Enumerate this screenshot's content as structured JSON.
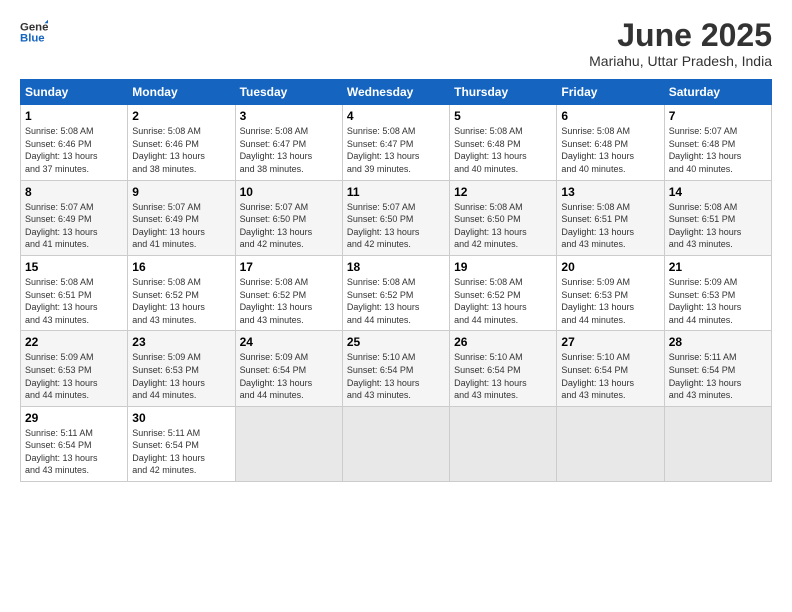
{
  "header": {
    "logo_line1": "General",
    "logo_line2": "Blue",
    "month": "June 2025",
    "location": "Mariahu, Uttar Pradesh, India"
  },
  "weekdays": [
    "Sunday",
    "Monday",
    "Tuesday",
    "Wednesday",
    "Thursday",
    "Friday",
    "Saturday"
  ],
  "weeks": [
    [
      {
        "day": "1",
        "info": "Sunrise: 5:08 AM\nSunset: 6:46 PM\nDaylight: 13 hours\nand 37 minutes."
      },
      {
        "day": "2",
        "info": "Sunrise: 5:08 AM\nSunset: 6:46 PM\nDaylight: 13 hours\nand 38 minutes."
      },
      {
        "day": "3",
        "info": "Sunrise: 5:08 AM\nSunset: 6:47 PM\nDaylight: 13 hours\nand 38 minutes."
      },
      {
        "day": "4",
        "info": "Sunrise: 5:08 AM\nSunset: 6:47 PM\nDaylight: 13 hours\nand 39 minutes."
      },
      {
        "day": "5",
        "info": "Sunrise: 5:08 AM\nSunset: 6:48 PM\nDaylight: 13 hours\nand 40 minutes."
      },
      {
        "day": "6",
        "info": "Sunrise: 5:08 AM\nSunset: 6:48 PM\nDaylight: 13 hours\nand 40 minutes."
      },
      {
        "day": "7",
        "info": "Sunrise: 5:07 AM\nSunset: 6:48 PM\nDaylight: 13 hours\nand 40 minutes."
      }
    ],
    [
      {
        "day": "8",
        "info": "Sunrise: 5:07 AM\nSunset: 6:49 PM\nDaylight: 13 hours\nand 41 minutes."
      },
      {
        "day": "9",
        "info": "Sunrise: 5:07 AM\nSunset: 6:49 PM\nDaylight: 13 hours\nand 41 minutes."
      },
      {
        "day": "10",
        "info": "Sunrise: 5:07 AM\nSunset: 6:50 PM\nDaylight: 13 hours\nand 42 minutes."
      },
      {
        "day": "11",
        "info": "Sunrise: 5:07 AM\nSunset: 6:50 PM\nDaylight: 13 hours\nand 42 minutes."
      },
      {
        "day": "12",
        "info": "Sunrise: 5:08 AM\nSunset: 6:50 PM\nDaylight: 13 hours\nand 42 minutes."
      },
      {
        "day": "13",
        "info": "Sunrise: 5:08 AM\nSunset: 6:51 PM\nDaylight: 13 hours\nand 43 minutes."
      },
      {
        "day": "14",
        "info": "Sunrise: 5:08 AM\nSunset: 6:51 PM\nDaylight: 13 hours\nand 43 minutes."
      }
    ],
    [
      {
        "day": "15",
        "info": "Sunrise: 5:08 AM\nSunset: 6:51 PM\nDaylight: 13 hours\nand 43 minutes."
      },
      {
        "day": "16",
        "info": "Sunrise: 5:08 AM\nSunset: 6:52 PM\nDaylight: 13 hours\nand 43 minutes."
      },
      {
        "day": "17",
        "info": "Sunrise: 5:08 AM\nSunset: 6:52 PM\nDaylight: 13 hours\nand 43 minutes."
      },
      {
        "day": "18",
        "info": "Sunrise: 5:08 AM\nSunset: 6:52 PM\nDaylight: 13 hours\nand 44 minutes."
      },
      {
        "day": "19",
        "info": "Sunrise: 5:08 AM\nSunset: 6:52 PM\nDaylight: 13 hours\nand 44 minutes."
      },
      {
        "day": "20",
        "info": "Sunrise: 5:09 AM\nSunset: 6:53 PM\nDaylight: 13 hours\nand 44 minutes."
      },
      {
        "day": "21",
        "info": "Sunrise: 5:09 AM\nSunset: 6:53 PM\nDaylight: 13 hours\nand 44 minutes."
      }
    ],
    [
      {
        "day": "22",
        "info": "Sunrise: 5:09 AM\nSunset: 6:53 PM\nDaylight: 13 hours\nand 44 minutes."
      },
      {
        "day": "23",
        "info": "Sunrise: 5:09 AM\nSunset: 6:53 PM\nDaylight: 13 hours\nand 44 minutes."
      },
      {
        "day": "24",
        "info": "Sunrise: 5:09 AM\nSunset: 6:54 PM\nDaylight: 13 hours\nand 44 minutes."
      },
      {
        "day": "25",
        "info": "Sunrise: 5:10 AM\nSunset: 6:54 PM\nDaylight: 13 hours\nand 43 minutes."
      },
      {
        "day": "26",
        "info": "Sunrise: 5:10 AM\nSunset: 6:54 PM\nDaylight: 13 hours\nand 43 minutes."
      },
      {
        "day": "27",
        "info": "Sunrise: 5:10 AM\nSunset: 6:54 PM\nDaylight: 13 hours\nand 43 minutes."
      },
      {
        "day": "28",
        "info": "Sunrise: 5:11 AM\nSunset: 6:54 PM\nDaylight: 13 hours\nand 43 minutes."
      }
    ],
    [
      {
        "day": "29",
        "info": "Sunrise: 5:11 AM\nSunset: 6:54 PM\nDaylight: 13 hours\nand 43 minutes."
      },
      {
        "day": "30",
        "info": "Sunrise: 5:11 AM\nSunset: 6:54 PM\nDaylight: 13 hours\nand 42 minutes."
      },
      {
        "day": "",
        "info": ""
      },
      {
        "day": "",
        "info": ""
      },
      {
        "day": "",
        "info": ""
      },
      {
        "day": "",
        "info": ""
      },
      {
        "day": "",
        "info": ""
      }
    ]
  ]
}
